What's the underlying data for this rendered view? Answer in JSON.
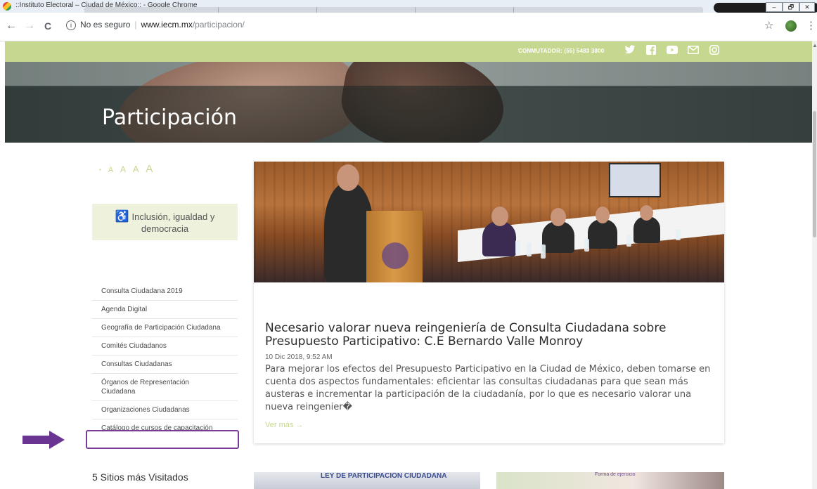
{
  "window": {
    "title": "::Instituto Electoral – Ciudad de México:: - Google Chrome",
    "min": "–",
    "restore": "🗗",
    "close": "✕"
  },
  "browser": {
    "back": "←",
    "forward": "→",
    "reload": "C",
    "security": "No es seguro",
    "domain": "www.iecm.mx",
    "path": "/participacion/",
    "star": "☆",
    "menu": "⋮"
  },
  "topbar": {
    "phone": "CONMUTADOR: (55) 5483 3800",
    "social": [
      "twitter-icon",
      "facebook-icon",
      "youtube-icon",
      "mail-icon",
      "instagram-icon"
    ]
  },
  "hero": {
    "title": "Participación"
  },
  "sidebar": {
    "font_sizer": [
      "A",
      "A",
      "A",
      "A"
    ],
    "inclusion_label": "Inclusión, igualdad y democracia",
    "items": [
      {
        "label": "Consulta Ciudadana 2019"
      },
      {
        "label": "Agenda Digital"
      },
      {
        "label": "Geografía de Participación Ciudadana"
      },
      {
        "label": "Comités Ciudadanos"
      },
      {
        "label": "Consultas Ciudadanas"
      },
      {
        "label": "Órganos de Representación Ciudadana"
      },
      {
        "label": "Organizaciones Ciudadanas"
      },
      {
        "label": "Catálogo de cursos de capacitación"
      }
    ],
    "sitios_heading": "5 Sitios más Visitados"
  },
  "news": {
    "title": "Necesario valorar nueva reingeniería de Consulta Ciudadana sobre Presupuesto Participativo: C.E Bernardo Valle Monroy",
    "date": "10 Dic 2018, 9:52 AM",
    "body": "Para mejorar los efectos del Presupuesto Participativo en la Ciudad de México, deben tomarse en cuenta dos aspectos fundamentales: eficientar las consultas ciudadanas para que sean más austeras e incrementar la participación de la ciudadanía, por lo que es necesario valorar una nueva reingenier�",
    "more": "Ver más →"
  },
  "thumbs": {
    "t1_text": "LEY DE PARTICIPACIÓN CIUDADANA",
    "t2_text": "Forma de ejercicio"
  },
  "colors": {
    "accent": "#c6d88f",
    "highlight": "#7a3a9a",
    "arrow": "#6a3592"
  }
}
